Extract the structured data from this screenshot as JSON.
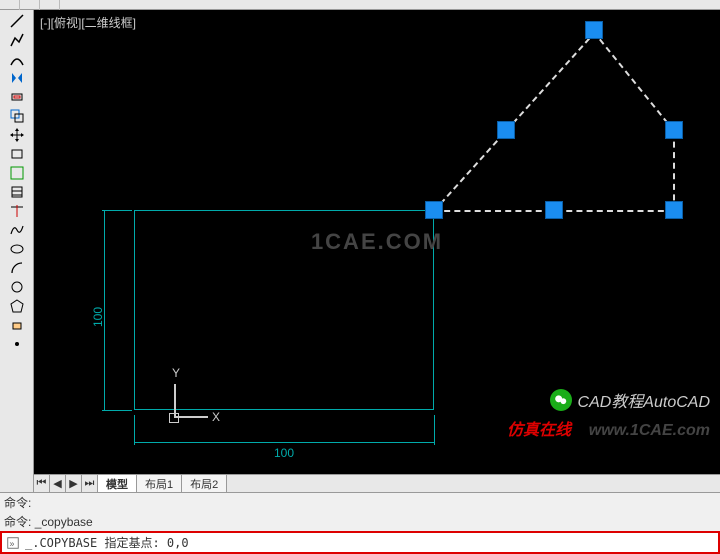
{
  "viewport_label": "[-][俯视][二维线框]",
  "watermark_center": "1CAE.COM",
  "watermark_right_1": "CAD教程AutoCAD",
  "watermark_right_2a": "仿真在线",
  "watermark_right_2b": "www.1CAE.com",
  "ucs": {
    "x": "X",
    "y": "Y"
  },
  "dimensions": {
    "dim_h": "100",
    "dim_v": "100"
  },
  "tabs": {
    "model": "模型",
    "layout1": "布局1",
    "layout2": "布局2"
  },
  "command": {
    "line1_prefix": "命令:",
    "line2_prefix": "命令:",
    "line2_text": "_copybase",
    "input_text": "_.COPYBASE 指定基点: 0,0"
  },
  "left_tools": [
    "line",
    "pline",
    "circle",
    "arc",
    "rect",
    "mirror",
    "offset",
    "copy",
    "move",
    "rotate",
    "scale",
    "stretch",
    "trim",
    "fillet",
    "region",
    "poly",
    "arc2",
    "spline",
    "ellipse",
    "point"
  ],
  "icons": {
    "first": "⏮",
    "prev": "◀",
    "next": "▶",
    "last": "⏭"
  }
}
